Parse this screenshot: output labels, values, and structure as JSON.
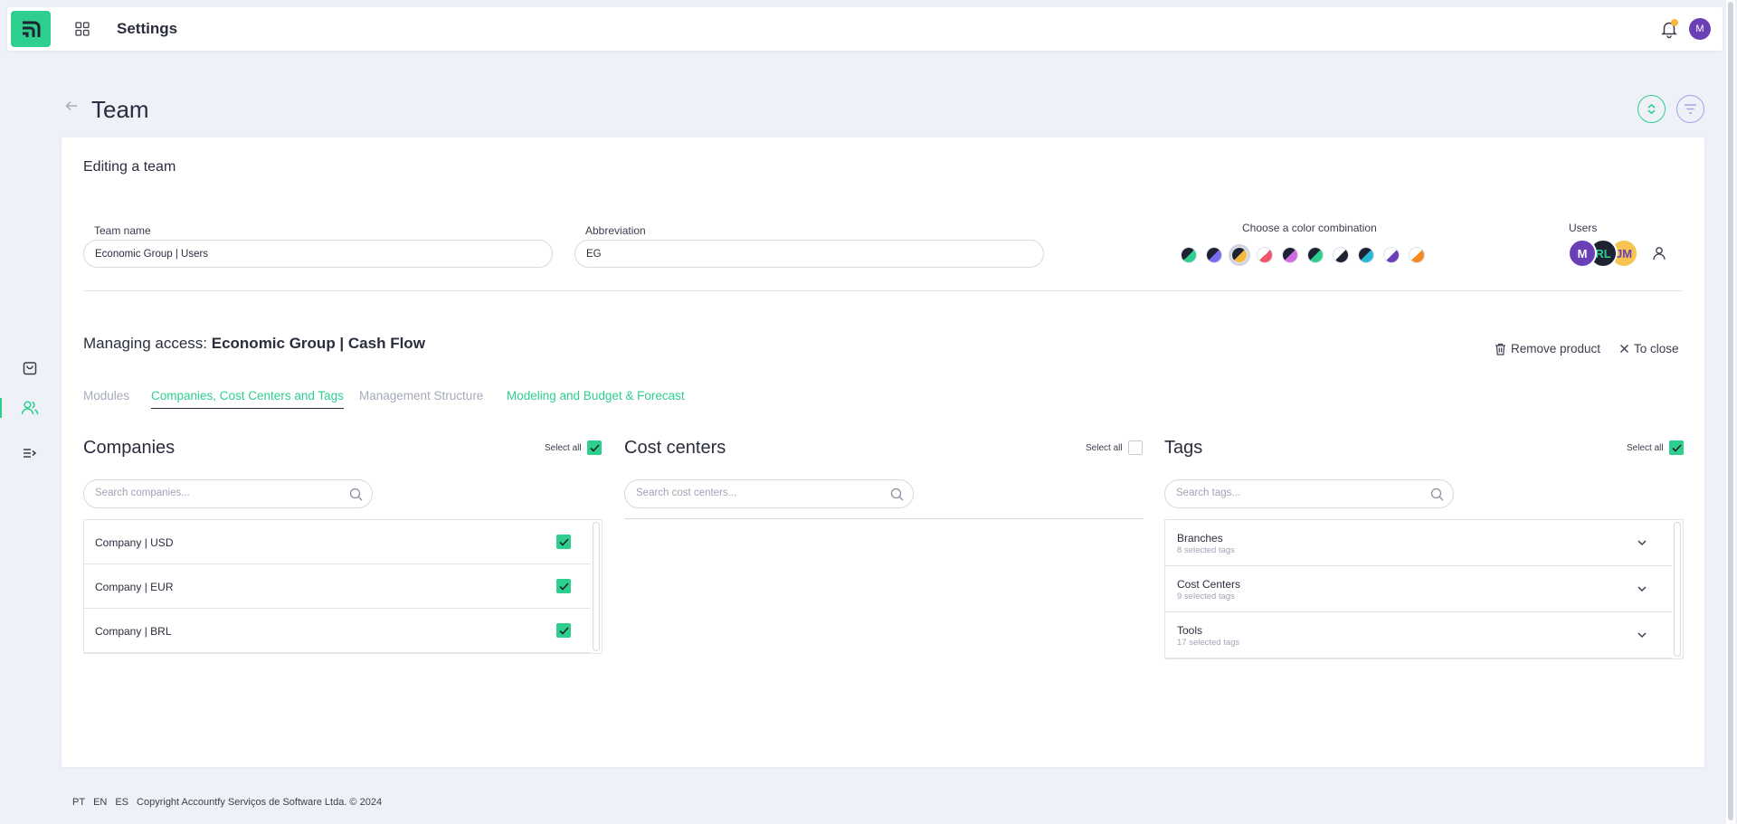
{
  "topbar": {
    "title": "Settings",
    "user_initial": "M"
  },
  "page": {
    "title": "Team"
  },
  "editor": {
    "heading": "Editing a team",
    "team_name_label": "Team name",
    "team_name_value": "Economic Group | Users",
    "abbreviation_label": "Abbreviation",
    "abbreviation_value": "EG",
    "color_label": "Choose a color combination",
    "colors": [
      {
        "fg": "#2ecf8e",
        "bg": "#1f2233"
      },
      {
        "fg": "#7a6cf0",
        "bg": "#1f2233"
      },
      {
        "fg": "#f6b93b",
        "bg": "#1f2233"
      },
      {
        "fg": "#f0566b",
        "bg": "#ffffff"
      },
      {
        "fg": "#d06ae0",
        "bg": "#1f2233"
      },
      {
        "fg": "#2ecf8e",
        "bg": "#1f2233"
      },
      {
        "fg": "#1f2233",
        "bg": "#ffffff"
      },
      {
        "fg": "#2bb6d6",
        "bg": "#1f2233"
      },
      {
        "fg": "#6b3fb6",
        "bg": "#ffffff"
      },
      {
        "fg": "#f58a1f",
        "bg": "#ffffff"
      }
    ],
    "selected_color_index": 2,
    "users_label": "Users",
    "users": [
      {
        "initials": "M",
        "bg": "#6b3fb6",
        "fg": "#ffffff"
      },
      {
        "initials": "RL",
        "bg": "#1f2233",
        "fg": "#2ecf8e"
      },
      {
        "initials": "JM",
        "bg": "#f6c44f",
        "fg": "#6b3fb6"
      }
    ]
  },
  "access": {
    "prefix": "Managing access: ",
    "product": "Economic Group | Cash Flow",
    "remove_label": "Remove product",
    "close_label": "To close",
    "tabs": [
      {
        "label": "Modules"
      },
      {
        "label": "Companies, Cost Centers and Tags"
      },
      {
        "label": "Management Structure"
      },
      {
        "label": "Modeling and Budget & Forecast"
      }
    ]
  },
  "companies": {
    "title": "Companies",
    "select_all_label": "Select all",
    "select_all_checked": true,
    "search_placeholder": "Search companies...",
    "items": [
      {
        "name": "Company | USD",
        "checked": true
      },
      {
        "name": "Company | EUR",
        "checked": true
      },
      {
        "name": "Company | BRL",
        "checked": true
      }
    ]
  },
  "cost_centers": {
    "title": "Cost centers",
    "select_all_label": "Select all",
    "select_all_checked": false,
    "search_placeholder": "Search cost centers..."
  },
  "tags": {
    "title": "Tags",
    "select_all_label": "Select all",
    "select_all_checked": true,
    "search_placeholder": "Search tags...",
    "groups": [
      {
        "name": "Branches",
        "count": "8 selected tags"
      },
      {
        "name": "Cost Centers",
        "count": "9 selected tags"
      },
      {
        "name": "Tools",
        "count": "17 selected tags"
      }
    ]
  },
  "footer": {
    "langs": [
      "PT",
      "EN",
      "ES"
    ],
    "copyright": "Copyright Accountfy Serviços de Software Ltda. © 2024"
  },
  "icons": {
    "logo": "accountfy-logo",
    "apps": "grid-icon",
    "bell": "bell-icon",
    "back": "arrow-left-icon",
    "expand": "expand-collapse-icon",
    "filter": "filter-icon",
    "bag": "shopping-bag-icon",
    "team": "users-icon",
    "list": "list-arrow-icon",
    "trash": "trash-icon",
    "close": "close-icon",
    "search": "search-icon",
    "check": "check-icon",
    "chevron": "chevron-down-icon",
    "add_user": "user-icon"
  },
  "colors": {
    "accent": "#2ecf8e",
    "purple": "#6b3fb6",
    "background": "#eef1f8"
  }
}
